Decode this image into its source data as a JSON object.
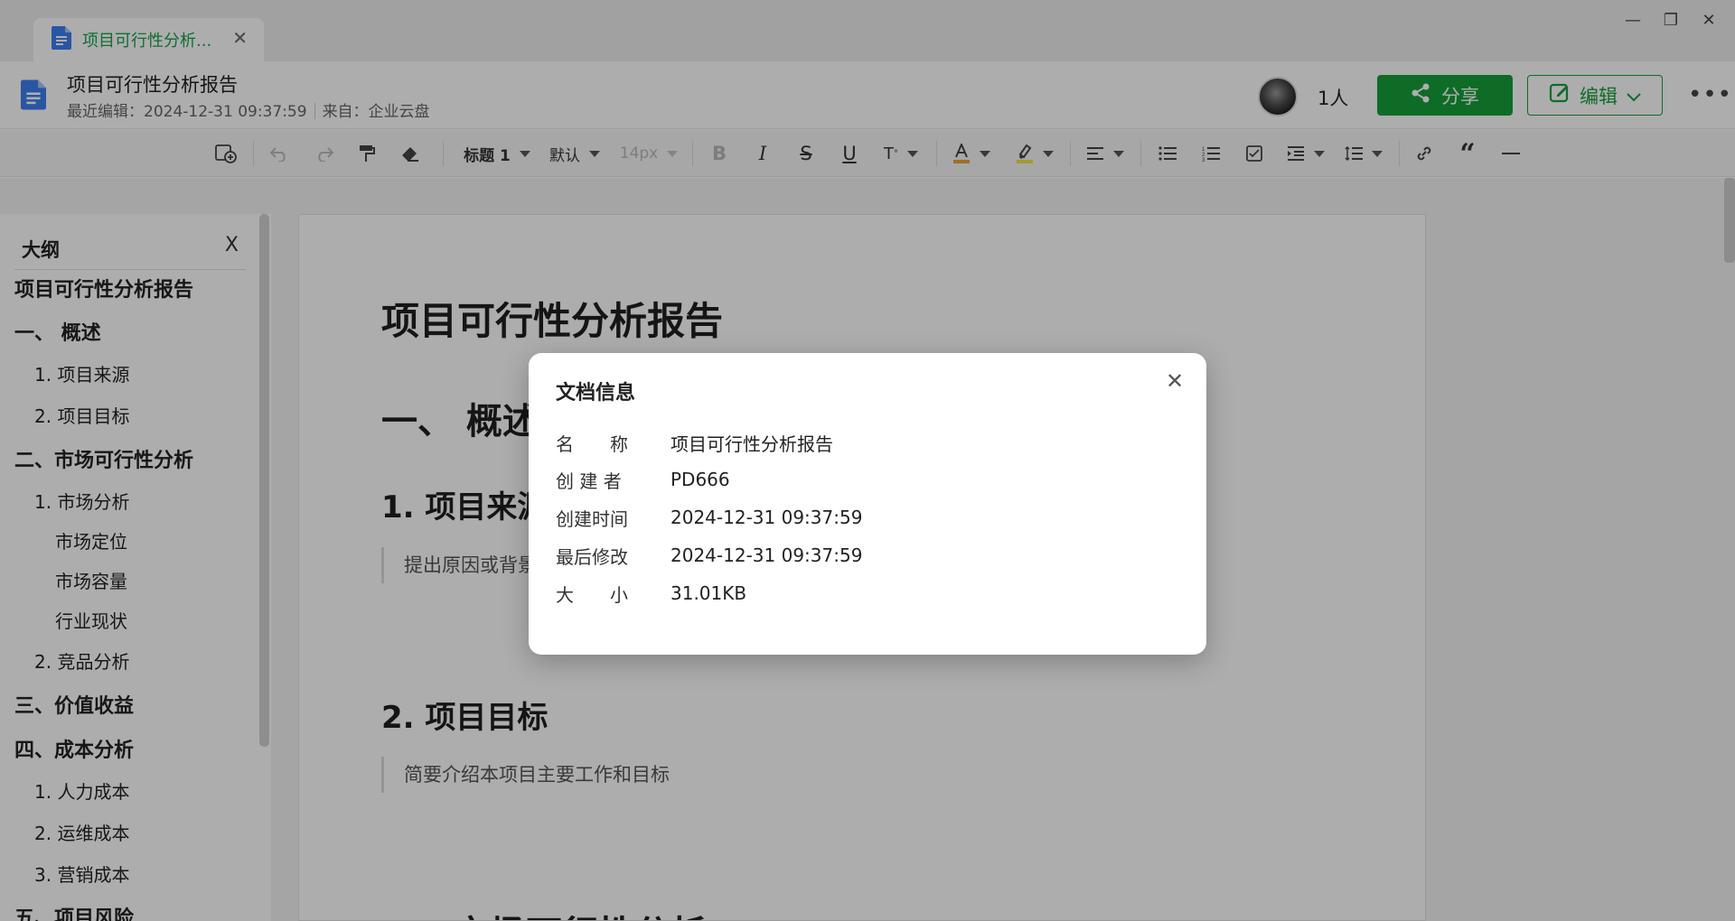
{
  "window": {
    "tab_title": "项目可行性分析...",
    "tab_close": "✕",
    "minimize": "—",
    "restore": "❐",
    "close": "✕"
  },
  "header": {
    "doc_title": "项目可行性分析报告",
    "last_edit": "最近编辑：2024-12-31 09:37:59",
    "source": "来自：企业云盘",
    "people_count": "1人",
    "share_label": "分享",
    "edit_label": "编辑",
    "more": "•••"
  },
  "toolbar": {
    "heading_style": "标题 1",
    "font_family": "默认",
    "font_size": "14px",
    "colors": {
      "text_color": "#e8a33d",
      "highlight_color": "#f2e24b",
      "brand": "#16a03a"
    },
    "icons": [
      "insert-icon",
      "undo-icon",
      "redo-icon",
      "format-painter-icon",
      "eraser-icon",
      "bold-icon",
      "italic-icon",
      "strikethrough-icon",
      "underline-icon",
      "superscript-icon",
      "text-color-icon",
      "highlight-icon",
      "align-icon",
      "bullet-list-icon",
      "ordered-list-icon",
      "checklist-icon",
      "indent-icon",
      "line-height-icon",
      "link-icon",
      "quote-icon",
      "divider-icon"
    ]
  },
  "outline": {
    "title": "大纲",
    "close": "X",
    "items": [
      {
        "level": 1,
        "text": "项目可行性分析报告"
      },
      {
        "level": 1,
        "text": "一、 概述"
      },
      {
        "level": 2,
        "text": "1. 项目来源"
      },
      {
        "level": 2,
        "text": "2. 项目目标"
      },
      {
        "level": 1,
        "text": "二、市场可行性分析"
      },
      {
        "level": 2,
        "text": "1. 市场分析"
      },
      {
        "level": 3,
        "text": "市场定位"
      },
      {
        "level": 3,
        "text": "市场容量"
      },
      {
        "level": 3,
        "text": "行业现状"
      },
      {
        "level": 2,
        "text": "2. 竞品分析"
      },
      {
        "level": 1,
        "text": "三、价值收益"
      },
      {
        "level": 1,
        "text": "四、成本分析"
      },
      {
        "level": 2,
        "text": "1. 人力成本"
      },
      {
        "level": 2,
        "text": "2. 运维成本"
      },
      {
        "level": 2,
        "text": "3. 营销成本"
      },
      {
        "level": 1,
        "text": "五、项目风险"
      }
    ]
  },
  "document": {
    "title": "项目可行性分析报告",
    "section1": "一、 概述",
    "sub1": "1. 项目来源",
    "sub1_quote": "提出原因或背景",
    "sub2": "2. 项目目标",
    "sub2_quote": "简要介绍本项目主要工作和目标",
    "section2": "二、市场可行性分析"
  },
  "modal": {
    "title": "文档信息",
    "close": "✕",
    "rows": [
      {
        "label": "名　　称",
        "value": "项目可行性分析报告"
      },
      {
        "label": "创 建 者",
        "value": "PD666"
      },
      {
        "label": "创建时间",
        "value": "2024-12-31 09:37:59"
      },
      {
        "label": "最后修改",
        "value": "2024-12-31 09:37:59"
      },
      {
        "label": "大　　小",
        "value": "31.01KB"
      }
    ]
  }
}
